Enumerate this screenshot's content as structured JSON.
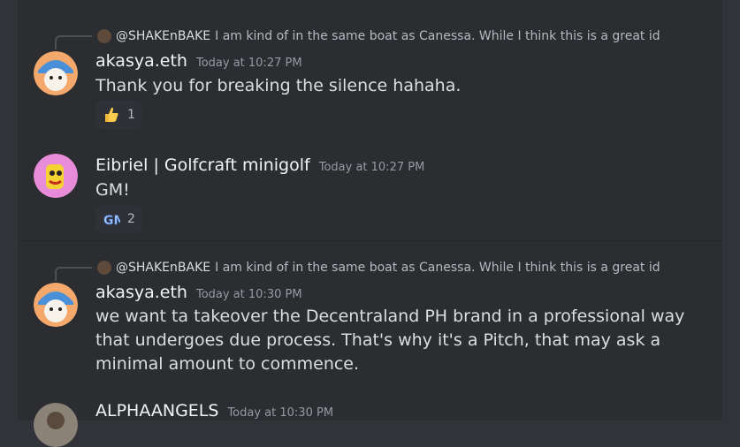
{
  "messages": [
    {
      "reply": {
        "username": "@SHAKEnBAKE",
        "text": "I am kind of in the same boat as Canessa. While I think this is a great id"
      },
      "username": "akasya.eth",
      "timestamp": "Today at 10:27 PM",
      "text": "Thank you for breaking the silence hahaha.",
      "reaction": {
        "emoji": "thumbs-up-emoji",
        "count": "1"
      }
    },
    {
      "username": "Eibriel | Golfcraft minigolf",
      "timestamp": "Today at 10:27 PM",
      "text": "GM!",
      "reaction": {
        "emoji": "gm-emoji",
        "count": "2"
      }
    },
    {
      "reply": {
        "username": "@SHAKEnBAKE",
        "text": "I am kind of in the same boat as Canessa. While I think this is a great id"
      },
      "username": "akasya.eth",
      "timestamp": "Today at 10:30 PM",
      "text_lines": [
        "we want ta takeover the Decentraland PH brand in a professional way",
        "that undergoes due process. That's why it's a Pitch, that may ask a",
        "minimal amount to commence."
      ]
    },
    {
      "username": "ALPHAANGELS",
      "timestamp": "Today at 10:30 PM"
    }
  ]
}
